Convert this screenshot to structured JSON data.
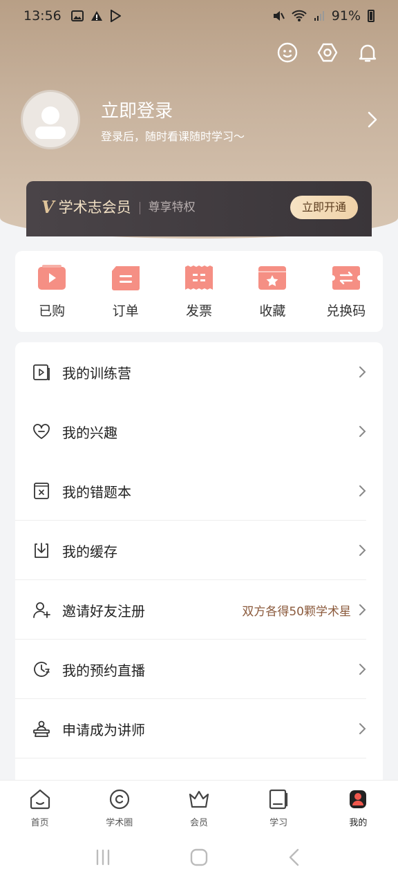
{
  "status_bar": {
    "time": "13:56",
    "battery": "91%"
  },
  "profile": {
    "title": "立即登录",
    "subtitle": "登录后，随时看课随时学习～"
  },
  "member": {
    "v_mark": "V",
    "title": "学术志会员",
    "subtitle": "尊享特权",
    "button": "立即开通"
  },
  "quick_actions": [
    {
      "label": "已购",
      "icon": "play-ticket-icon"
    },
    {
      "label": "订单",
      "icon": "order-icon"
    },
    {
      "label": "发票",
      "icon": "invoice-icon"
    },
    {
      "label": "收藏",
      "icon": "favorite-star-icon"
    },
    {
      "label": "兑换码",
      "icon": "exchange-code-icon"
    }
  ],
  "menu": [
    {
      "label": "我的训练营",
      "icon": "video-folder-icon"
    },
    {
      "label": "我的兴趣",
      "icon": "heart-icon"
    },
    {
      "label": "我的错题本",
      "icon": "wrong-book-icon"
    },
    {
      "label": "我的缓存",
      "icon": "download-icon"
    },
    {
      "label": "邀请好友注册",
      "icon": "add-user-icon",
      "extra": "双方各得50颗学术星"
    },
    {
      "label": "我的预约直播",
      "icon": "clock-icon"
    },
    {
      "label": "申请成为讲师",
      "icon": "lecturer-icon"
    }
  ],
  "bottom_nav": [
    {
      "label": "首页",
      "icon": "home-icon"
    },
    {
      "label": "学术圈",
      "icon": "circle-icon"
    },
    {
      "label": "会员",
      "icon": "crown-icon"
    },
    {
      "label": "学习",
      "icon": "notebook-icon"
    },
    {
      "label": "我的",
      "icon": "profile-icon",
      "active": true
    }
  ],
  "colors": {
    "accent": "#f27f76",
    "brand_brown": "#b89f86",
    "member_dark": "#3f3a3e"
  }
}
